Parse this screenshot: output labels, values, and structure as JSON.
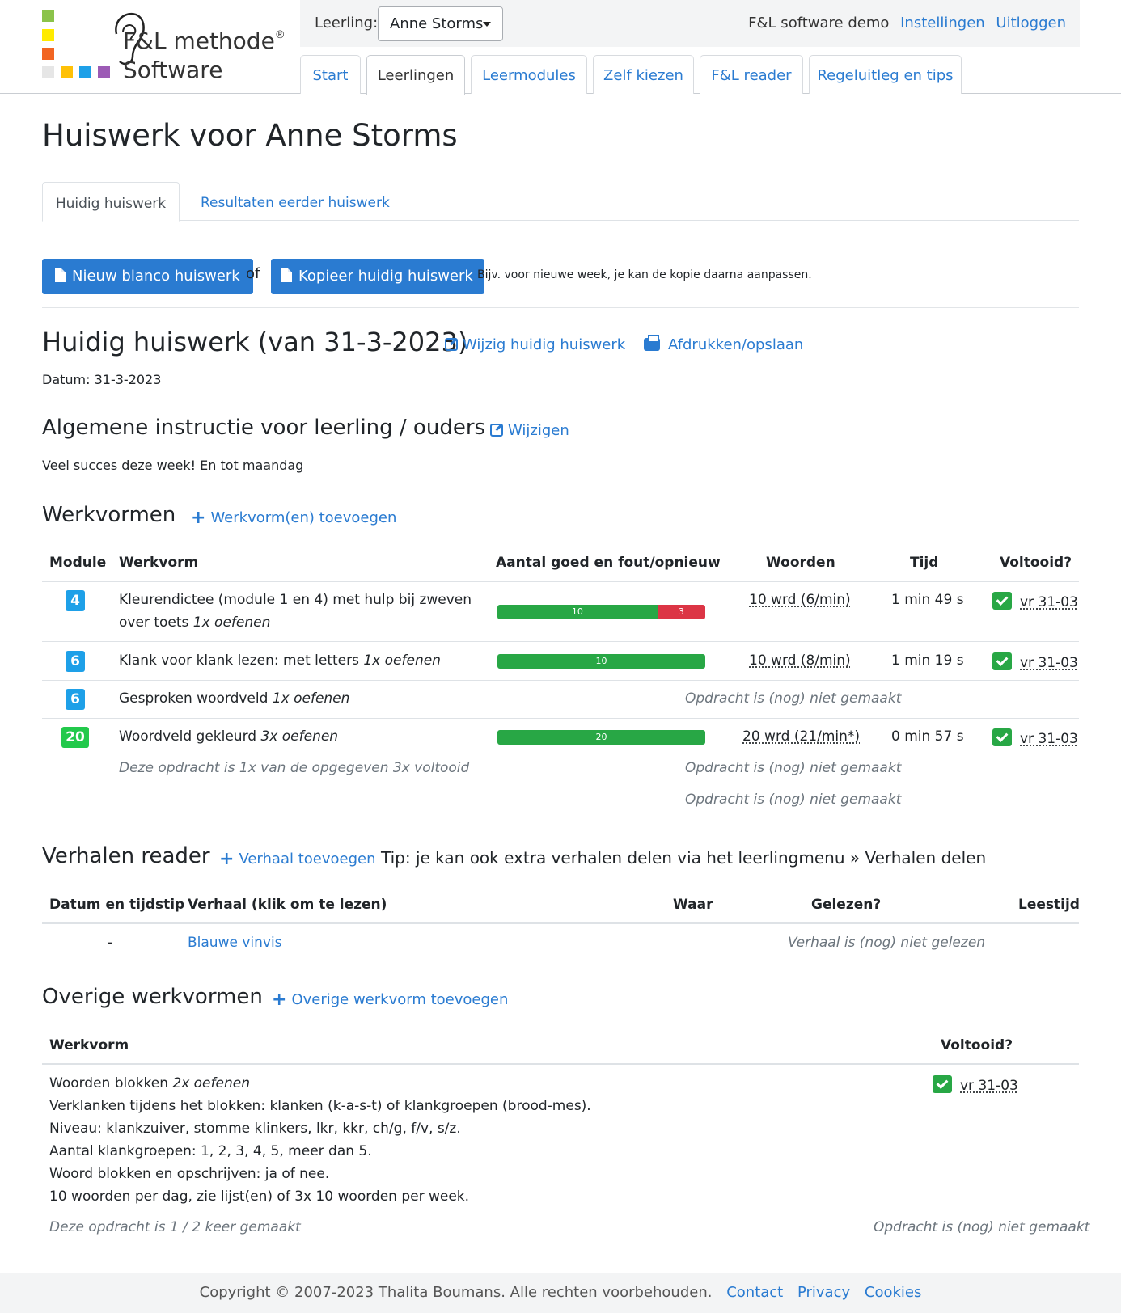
{
  "logo": {
    "line1": "F&L methode",
    "reg": "®",
    "line2": "Software"
  },
  "topbar": {
    "leerling_label": "Leerling:",
    "student": "Anne Storms",
    "account": "F&L software demo",
    "settings": "Instellingen",
    "logout": "Uitloggen"
  },
  "nav": [
    "Start",
    "Leerlingen",
    "Leermodules",
    "Zelf kiezen",
    "F&L reader",
    "Regeluitleg en tips"
  ],
  "page_title": "Huiswerk voor Anne Storms",
  "subtabs": [
    "Huidig huiswerk",
    "Resultaten eerder huiswerk"
  ],
  "actions": {
    "new_blank": "Nieuw blanco huiswerk",
    "or": "of",
    "copy": "Kopieer huidig huiswerk",
    "copy_hint": "Bijv. voor nieuwe week, je kan de kopie daarna aanpassen."
  },
  "current": {
    "title": "Huidig huiswerk (van 31-3-2023)",
    "edit": "Wijzig huidig huiswerk",
    "print": "Afdrukken/opslaan",
    "date": "Datum: 31-3-2023"
  },
  "instruction": {
    "title": "Algemene instructie voor leerling / ouders",
    "edit": "Wijzigen",
    "text": "Veel succes deze week! En tot maandag"
  },
  "werkvormen": {
    "title": "Werkvormen",
    "add": "Werkvorm(en) toevoegen",
    "headers": [
      "Module",
      "Werkvorm",
      "Aantal goed en fout/opnieuw",
      "Woorden",
      "Tijd",
      "Voltooid?"
    ],
    "rows": [
      {
        "module": "4",
        "name_line1": "Kleurendictee (module 1 en 4) met hulp bij zweven",
        "name_line2": "over toets ",
        "freq": "1x oefenen",
        "good": 10,
        "bad": 3,
        "good_label": "10",
        "bad_label": "3",
        "words": "10 wrd (6/min)",
        "time": "1 min 49 s",
        "done": "vr 31-03"
      },
      {
        "module": "6",
        "name": "Klank voor klank lezen: met letters ",
        "freq": "1x oefenen",
        "good": 10,
        "bad": 0,
        "good_label": "10",
        "words": "10 wrd (8/min)",
        "time": "1 min 19 s",
        "done": "vr 31-03"
      },
      {
        "module": "6",
        "name": "Gesproken woordveld ",
        "freq": "1x oefenen",
        "status": "Opdracht is (nog) niet gemaakt"
      },
      {
        "module": "20",
        "name": "Woordveld gekleurd ",
        "freq": "3x oefenen",
        "good": 20,
        "bad": 0,
        "good_label": "20",
        "words": "20 wrd (21/min*)",
        "time": "0 min 57 s",
        "done": "vr 31-03",
        "note": "Deze opdracht is 1x van de opgegeven 3x voltooid",
        "status1": "Opdracht is (nog) niet gemaakt",
        "status2": "Opdracht is (nog) niet gemaakt"
      }
    ]
  },
  "reader": {
    "title": "Verhalen reader",
    "add": "Verhaal toevoegen",
    "tip": "Tip: je kan ook extra verhalen delen via het leerlingmenu » Verhalen delen",
    "headers": [
      "Datum en tijdstip",
      "Verhaal (klik om te lezen)",
      "Waar",
      "Gelezen?",
      "Leestijd"
    ],
    "row": {
      "date": "-",
      "story": "Blauwe vinvis",
      "status": "Verhaal is (nog) niet gelezen"
    }
  },
  "overige": {
    "title": "Overige werkvormen",
    "add": "Overige werkvorm toevoegen",
    "headers": [
      "Werkvorm",
      "Voltooid?"
    ],
    "item": {
      "name": "Woorden blokken ",
      "freq": "2x oefenen",
      "lines": [
        "Verklanken tijdens het blokken: klanken (k-a-s-t) of klankgroepen (brood-mes).",
        "Niveau: klankzuiver, stomme klinkers, lkr, kkr, ch/g, f/v, s/z.",
        "Aantal klankgroepen: 1, 2, 3, 4, 5, meer dan 5.",
        "Woord blokken en opschrijven: ja of nee.",
        "10 woorden per dag, zie lijst(en) of 3x 10 woorden per week."
      ],
      "note": "Deze opdracht is 1 / 2 keer gemaakt",
      "done": "vr 31-03",
      "status": "Opdracht is (nog) niet gemaakt"
    }
  },
  "footer": {
    "copyright": "Copyright © 2007-2023 Thalita Boumans. Alle rechten voorbehouden.",
    "links": [
      "Contact",
      "Privacy",
      "Cookies"
    ]
  },
  "colors": {
    "accent": "#2a7bd1",
    "success": "#28a745",
    "danger": "#dc3545",
    "badge_blue": "#1ea0e8",
    "badge_green": "#22c94b"
  }
}
